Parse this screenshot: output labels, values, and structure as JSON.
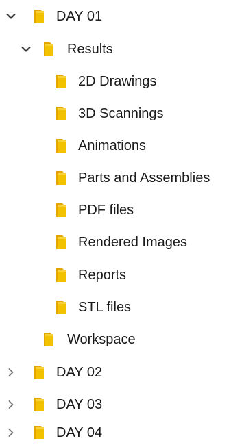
{
  "tree": {
    "day01": {
      "label": "DAY 01",
      "chevron_icon": "chevron-down-icon",
      "results": {
        "label": "Results",
        "chevron_icon": "chevron-down-icon",
        "children": [
          {
            "label": "2D Drawings"
          },
          {
            "label": "3D Scannings"
          },
          {
            "label": "Animations"
          },
          {
            "label": "Parts and Assemblies"
          },
          {
            "label": "PDF files"
          },
          {
            "label": "Rendered Images"
          },
          {
            "label": "Reports"
          },
          {
            "label": "STL files"
          }
        ]
      },
      "workspace": {
        "label": "Workspace"
      }
    },
    "day02": {
      "label": "DAY 02",
      "chevron_icon": "chevron-right-icon"
    },
    "day03": {
      "label": "DAY 03",
      "chevron_icon": "chevron-right-icon"
    },
    "day04": {
      "label": "DAY 04",
      "chevron_icon": "chevron-right-icon"
    }
  },
  "colors": {
    "folder": "#F2C100",
    "folder_back": "#E0A800",
    "chevron_expanded": "#333333",
    "chevron_collapsed": "#7a7a7a"
  },
  "icons": {
    "folder": "folder-icon"
  }
}
